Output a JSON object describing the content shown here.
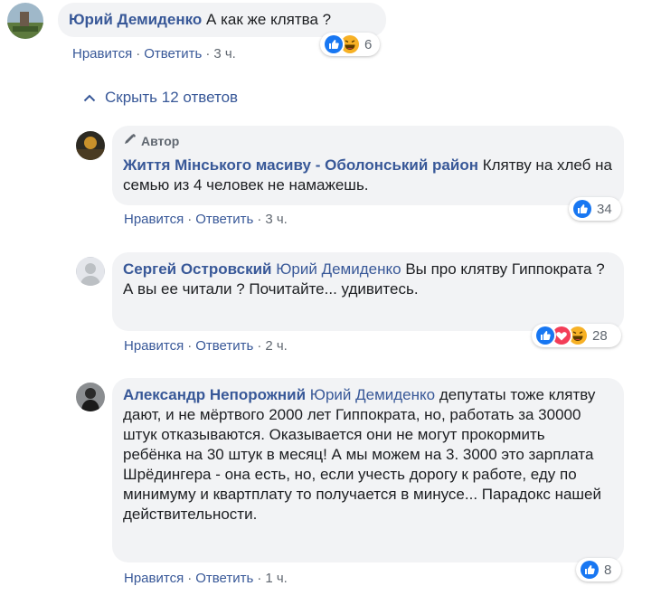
{
  "colors": {
    "link": "#385898",
    "bubble": "#f2f3f5",
    "meta": "#606770",
    "like": "#1877f2",
    "love": "#f33e58",
    "haha": "#f7b125"
  },
  "comments": [
    {
      "author": "Юрий Демиденко",
      "text": "А как же клятва ?",
      "actions": {
        "like": "Нравится",
        "reply": "Ответить",
        "time": "3 ч."
      },
      "reactions": {
        "icons": [
          "like-icon",
          "haha-icon"
        ],
        "count": "6"
      }
    }
  ],
  "replies_toggle": {
    "label": "Скрыть 12 ответов",
    "icon": "chevron-up-icon"
  },
  "replies": [
    {
      "badge": "Автор",
      "author": "Життя Мінського масиву - Оболонський район",
      "text": "Клятву на хлеб на семью из 4 человек не намажешь.",
      "actions": {
        "like": "Нравится",
        "reply": "Ответить",
        "time": "3 ч."
      },
      "reactions": {
        "icons": [
          "like-icon"
        ],
        "count": "34"
      }
    },
    {
      "author": "Сергей Островский",
      "mention": "Юрий Демиденко",
      "text_line1": "Вы про клятву Гиппократа ?",
      "text_line2": "А вы ее читали ? Почитайте... удивитесь.",
      "actions": {
        "like": "Нравится",
        "reply": "Ответить",
        "time": "2 ч."
      },
      "reactions": {
        "icons": [
          "like-icon",
          "love-icon",
          "haha-icon"
        ],
        "count": "28"
      }
    },
    {
      "author": "Александр Непорожний",
      "mention": "Юрий Демиденко",
      "text": "депутаты тоже клятву дают, и не мёртвого 2000 лет Гиппократа, но, работать за 30000 штук отказываются. Оказывается они не могут прокормить ребёнка на 30 штук в месяц! А мы можем на 3. 3000 это зарплата Шрёдингера - она есть, но, если учесть дорогу к работе, еду по минимуму и квартплату то получается в минусе... Парадокс нашей действительности.",
      "actions": {
        "like": "Нравится",
        "reply": "Ответить",
        "time": "1 ч."
      },
      "reactions": {
        "icons": [
          "like-icon"
        ],
        "count": "8"
      }
    }
  ]
}
